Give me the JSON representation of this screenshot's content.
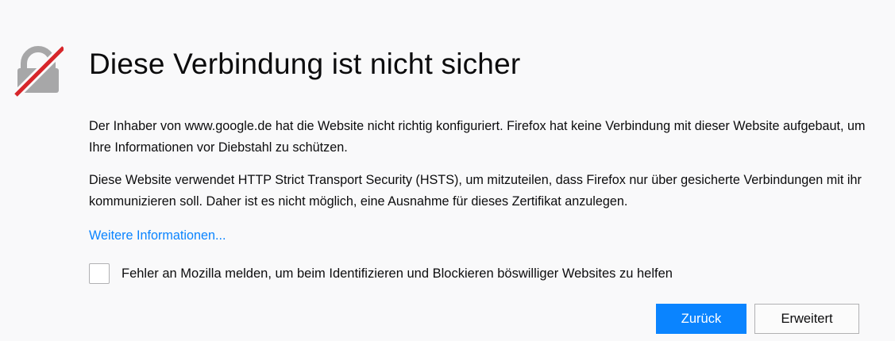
{
  "colors": {
    "background": "#f9f9fa",
    "accent": "#0a84ff",
    "lock_gray": "#a7a7a8",
    "lock_strike": "#d7262a"
  },
  "icon": {
    "name": "lock-broken-icon"
  },
  "error": {
    "title": "Diese Verbindung ist nicht sicher",
    "paragraph1": "Der Inhaber von www.google.de hat die Website nicht richtig konfiguriert. Firefox hat keine Verbindung mit dieser Website aufgebaut, um Ihre Informationen vor Diebstahl zu schützen.",
    "paragraph2": "Diese Website verwendet HTTP Strict Transport Security (HSTS), um mitzuteilen, dass Firefox nur über gesicherte Verbindungen mit ihr kommunizieren soll. Daher ist es nicht möglich, eine Ausnahme für dieses Zertifikat anzulegen.",
    "learn_more": "Weitere Informationen..."
  },
  "report": {
    "checked": false,
    "label": "Fehler an Mozilla melden, um beim Identifizieren und Blockieren böswilliger Websites zu helfen"
  },
  "buttons": {
    "back": "Zurück",
    "advanced": "Erweitert"
  }
}
